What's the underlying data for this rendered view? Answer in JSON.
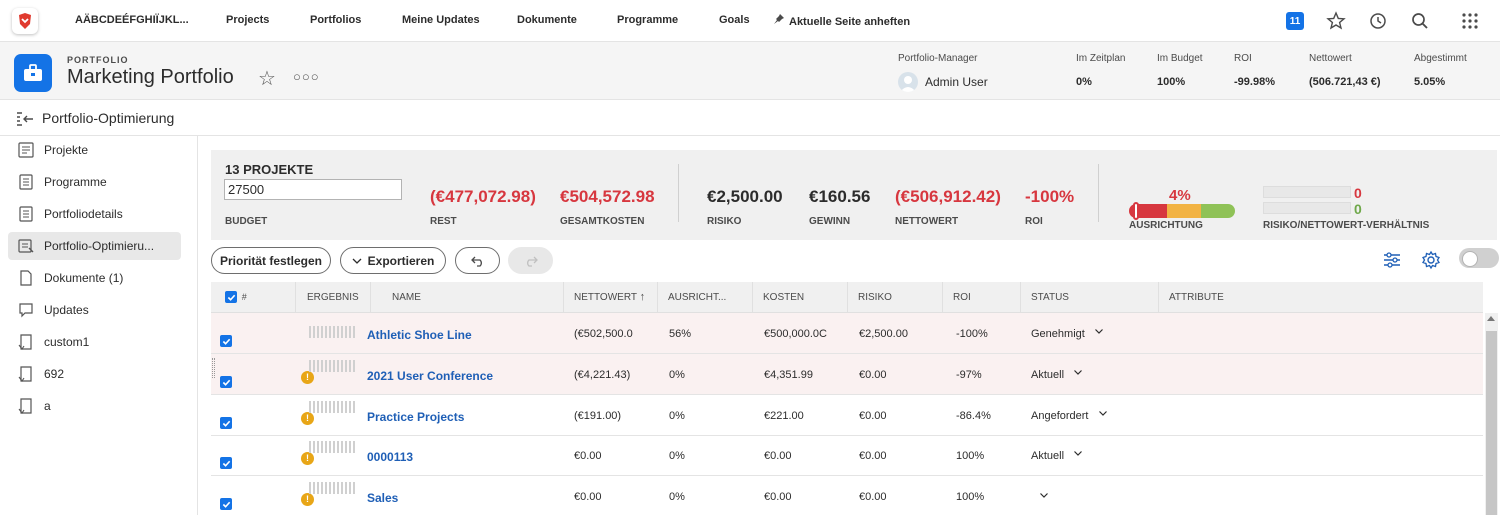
{
  "topnav": {
    "user": "AÄBCDEÉFGHIÏJKL...",
    "items": [
      "Projects",
      "Portfolios",
      "Meine Updates",
      "Dokumente",
      "Programme",
      "Goals"
    ],
    "pin_label": "Aktuelle Seite anheften",
    "badge": "11",
    "icons": [
      "star-icon",
      "history-icon",
      "search-icon",
      "apps-grid-icon"
    ]
  },
  "header": {
    "kicker": "PORTFOLIO",
    "title": "Marketing Portfolio",
    "manager_label": "Portfolio-Manager",
    "manager_name": "Admin User",
    "stats": [
      {
        "label": "Im Zeitplan",
        "value": "0%"
      },
      {
        "label": "Im Budget",
        "value": "100%"
      },
      {
        "label": "ROI",
        "value": "-99.98%"
      },
      {
        "label": "Nettowert",
        "value": "(506.721,43 €)"
      },
      {
        "label": "Abgestimmt",
        "value": "5.05%"
      }
    ]
  },
  "subheader": {
    "title": "Portfolio-Optimierung"
  },
  "sidebar": {
    "items": [
      {
        "label": "Projekte",
        "icon": "projects-icon"
      },
      {
        "label": "Programme",
        "icon": "programs-icon"
      },
      {
        "label": "Portfoliodetails",
        "icon": "details-icon"
      },
      {
        "label": "Portfolio-Optimieru...",
        "icon": "optimizer-icon",
        "active": true
      },
      {
        "label": "Dokumente (1)",
        "icon": "documents-icon"
      },
      {
        "label": "Updates",
        "icon": "updates-icon"
      },
      {
        "label": "custom1",
        "icon": "custom-tab-icon"
      },
      {
        "label": "692",
        "icon": "custom-tab-icon"
      },
      {
        "label": "a",
        "icon": "custom-tab-icon"
      }
    ]
  },
  "summary": {
    "count": "13 PROJEKTE",
    "budget_value": "27500",
    "budget_label": "BUDGET",
    "rest_value": "(€477,072.98)",
    "rest_label": "REST",
    "total_value": "€504,572.98",
    "total_label": "GESAMTKOSTEN",
    "risk_value": "€2,500.00",
    "risk_label": "RISIKO",
    "profit_value": "€160.56",
    "profit_label": "GEWINN",
    "net_value": "(€506,912.42)",
    "net_label": "NETTOWERT",
    "roi_value": "-100%",
    "roi_label": "ROI",
    "alignment_value": "4%",
    "alignment_label": "AUSRICHTUNG",
    "alignment_fraction": 0.04,
    "ratio_value_1": "0",
    "ratio_value_2": "0",
    "ratio_label": "RISIKO/NETTOWERT-VERHÄLTNIS",
    "colors": {
      "red": "#d7373f",
      "orange": "#f2b343",
      "green": "#8fc257"
    }
  },
  "toolbar": {
    "priority_label": "Priorität festlegen",
    "export_label": "Exportieren"
  },
  "table": {
    "headers": [
      "#",
      "ERGEBNIS",
      "NAME",
      "NETTOWERT",
      "AUSRICHT...",
      "KOSTEN",
      "RISIKO",
      "ROI",
      "STATUS",
      "ATTRIBUTE"
    ],
    "rows": [
      {
        "name": "Athletic Shoe Line",
        "net": "(€502,500.0",
        "align": "56%",
        "cost": "€500,000.0C",
        "risk": "€2,500.00",
        "roi": "-100%",
        "status": "Genehmigt",
        "warn": false
      },
      {
        "name": "2021 User Conference",
        "net": "(€4,221.43)",
        "align": "0%",
        "cost": "€4,351.99",
        "risk": "€0.00",
        "roi": "-97%",
        "status": "Aktuell",
        "warn": true
      },
      {
        "name": "Practice Projects",
        "net": "(€191.00)",
        "align": "0%",
        "cost": "€221.00",
        "risk": "€0.00",
        "roi": "-86.4%",
        "status": "Angefordert",
        "warn": true
      },
      {
        "name": "0000113",
        "net": "€0.00",
        "align": "0%",
        "cost": "€0.00",
        "risk": "€0.00",
        "roi": "100%",
        "status": "Aktuell",
        "warn": true
      },
      {
        "name": "Sales",
        "net": "€0.00",
        "align": "0%",
        "cost": "€0.00",
        "risk": "€0.00",
        "roi": "100%",
        "status": "",
        "warn": true
      }
    ]
  }
}
